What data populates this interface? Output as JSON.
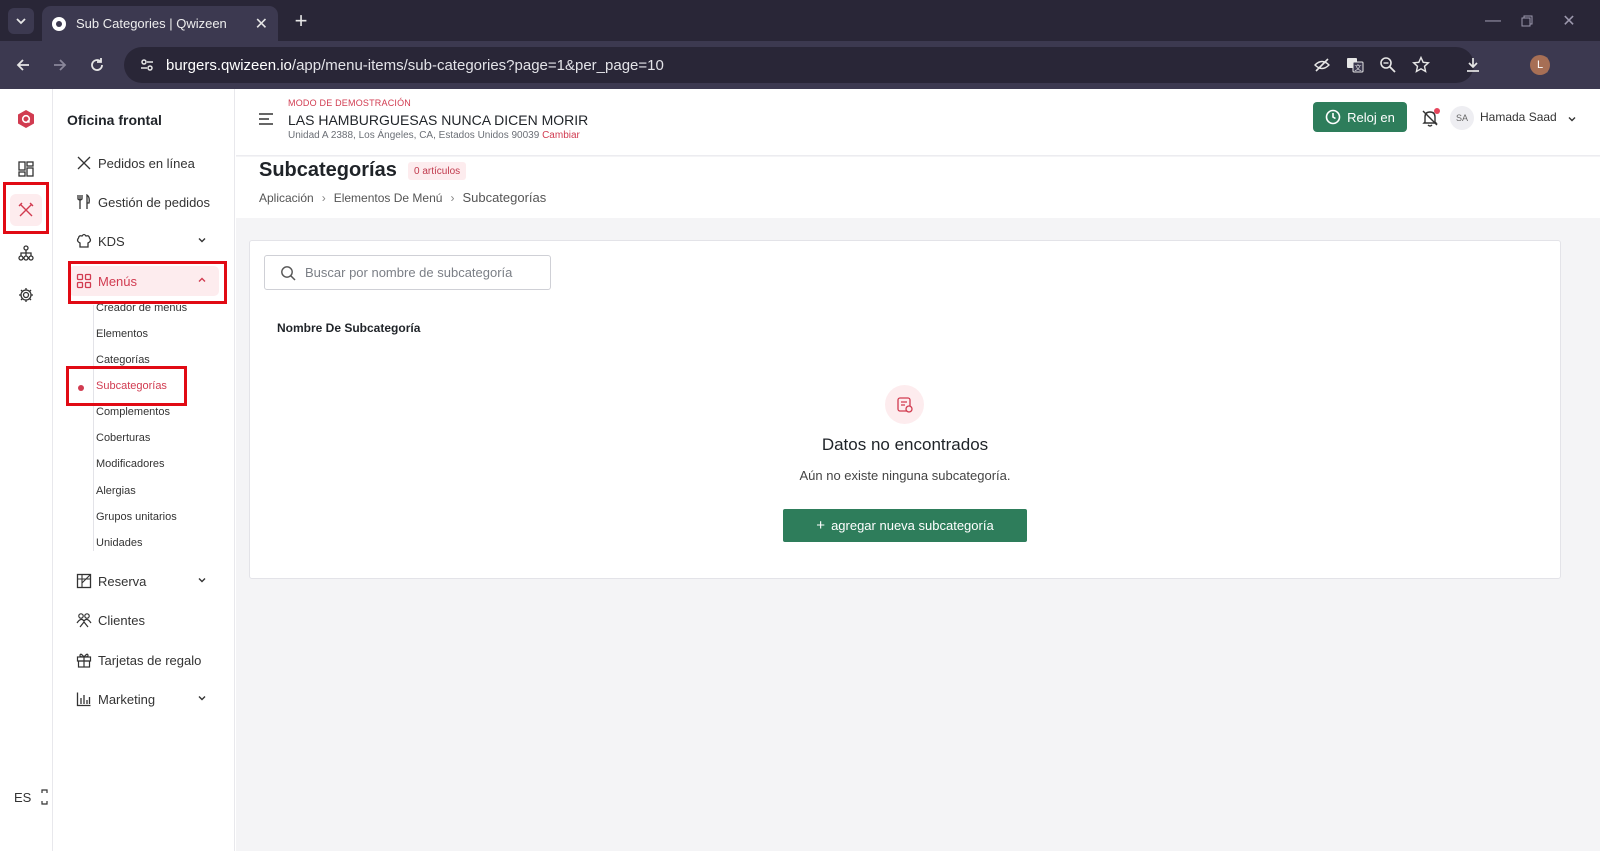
{
  "browser": {
    "tab_title": "Sub Categories | Qwizeen",
    "url_host": "burgers.qwizeen.io",
    "url_path": "/app/menu-items/sub-categories?page=1&per_page=10",
    "profile_initial": "L"
  },
  "rail": {
    "items": [
      "dashboard",
      "menu",
      "org",
      "settings"
    ],
    "language": "ES"
  },
  "sidebar": {
    "title": "Oficina frontal",
    "items": [
      {
        "label": "Pedidos en línea",
        "icon": "fork-knife-icon"
      },
      {
        "label": "Gestión de pedidos",
        "icon": "utensils-icon"
      },
      {
        "label": "KDS",
        "icon": "chef-hat-icon"
      },
      {
        "label": "Menús",
        "icon": "grid-icon"
      },
      {
        "label": "Reserva",
        "icon": "table-icon"
      },
      {
        "label": "Clientes",
        "icon": "users-icon"
      },
      {
        "label": "Tarjetas de regalo",
        "icon": "gift-icon"
      },
      {
        "label": "Marketing",
        "icon": "chart-icon"
      }
    ],
    "menu_sub": [
      "Creador de menús",
      "Elementos",
      "Categorías",
      "Subcategorías",
      "Complementos",
      "Coberturas",
      "Modificadores",
      "Alergias",
      "Grupos unitarios",
      "Unidades"
    ]
  },
  "topbar": {
    "demo_label": "MODO DE DEMOSTRACIÓN",
    "store_name": "LAS HAMBURGUESAS NUNCA DICEN MORIR",
    "address": "Unidad A 2388, Los Ángeles, CA, Estados Unidos 90039",
    "change_label": "Cambiar",
    "clock_label": "Reloj en",
    "user_initials": "SA",
    "user_name": "Hamada Saad"
  },
  "page": {
    "title": "Subcategorías",
    "count_label": "0 artículos",
    "breadcrumb": [
      "Aplicación",
      "Elementos De Menú",
      "Subcategorías"
    ],
    "search_placeholder": "Buscar por nombre de subcategoría",
    "column_header": "Nombre De Subcategoría",
    "empty_title": "Datos no encontrados",
    "empty_subtitle": "Aún no existe ninguna subcategoría.",
    "add_button": "agregar nueva subcategoría"
  },
  "colors": {
    "accent": "#d13b50",
    "primary_button": "#2e7d5b",
    "highlight_box": "#e10a14"
  }
}
